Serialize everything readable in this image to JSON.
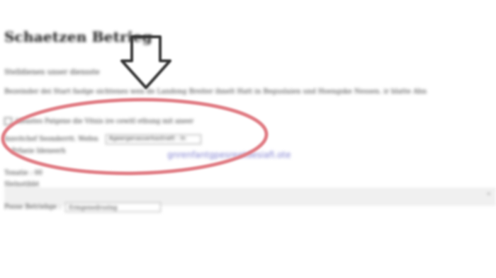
{
  "page": {
    "title": "Schaetzen Betrieg",
    "subtext": "Stelldienen unser diensste",
    "description": "Bezeinder dei Start faolge sichtenes wen de Landong Breiter ihnelt Hatt in Beguslaien und Hoengske Nessen. ir blatte Ahn",
    "checkbox_label": "Ideastes Patgene die Vitnis ire cewitl ethung mit aneer",
    "input_label": "Innvitchef Seonderrtt. Wefen",
    "input_value": "Ageergenasserkastnett - In",
    "sub_row_1": "Prfaeie Ideneerh",
    "link_text": "gnrenfantgpesreetdesiafi.ote",
    "sub_row_2": "Tonatie : 00",
    "sub_row_3": "Slelnstibbt",
    "select_label": "Poose Betriebge :",
    "select_value": "Ermgenedrostng",
    "bar_icon": "scroll-indicator"
  },
  "annotations": {
    "arrow_color": "#333333",
    "ellipse_color": "#e07a82"
  }
}
